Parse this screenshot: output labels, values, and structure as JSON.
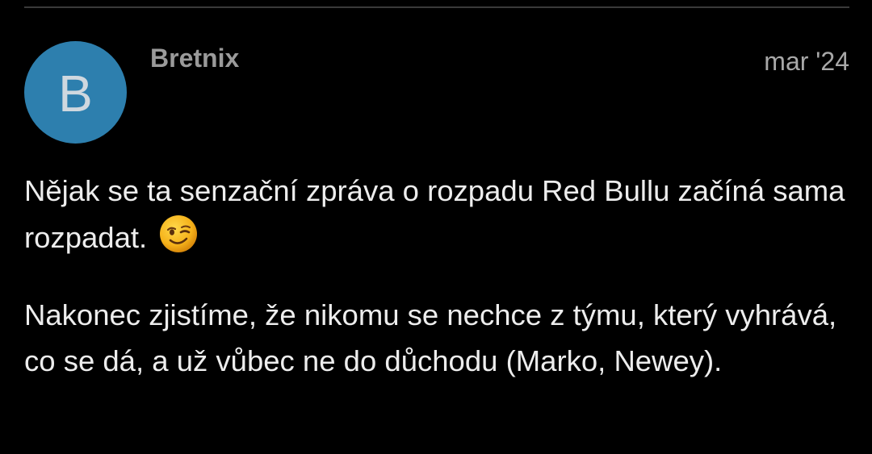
{
  "post": {
    "author": {
      "avatar_letter": "B",
      "username": "Bretnix"
    },
    "date": "mar '24",
    "paragraphs": [
      "Nějak se ta senzační zpráva o rozpadu Red Bullu začíná sama rozpadat.",
      "Nakonec zjistíme, že nikomu se nechce z týmu, který vyhrává, co se dá, a už vůbec ne do důchodu (Marko, Newey)."
    ],
    "emoji": "winking-face-icon"
  },
  "colors": {
    "background": "#000000",
    "avatar_bg": "#2d7fae",
    "username": "#9a9a9a",
    "body_text": "#ededed",
    "divider": "#3a3a3a"
  }
}
